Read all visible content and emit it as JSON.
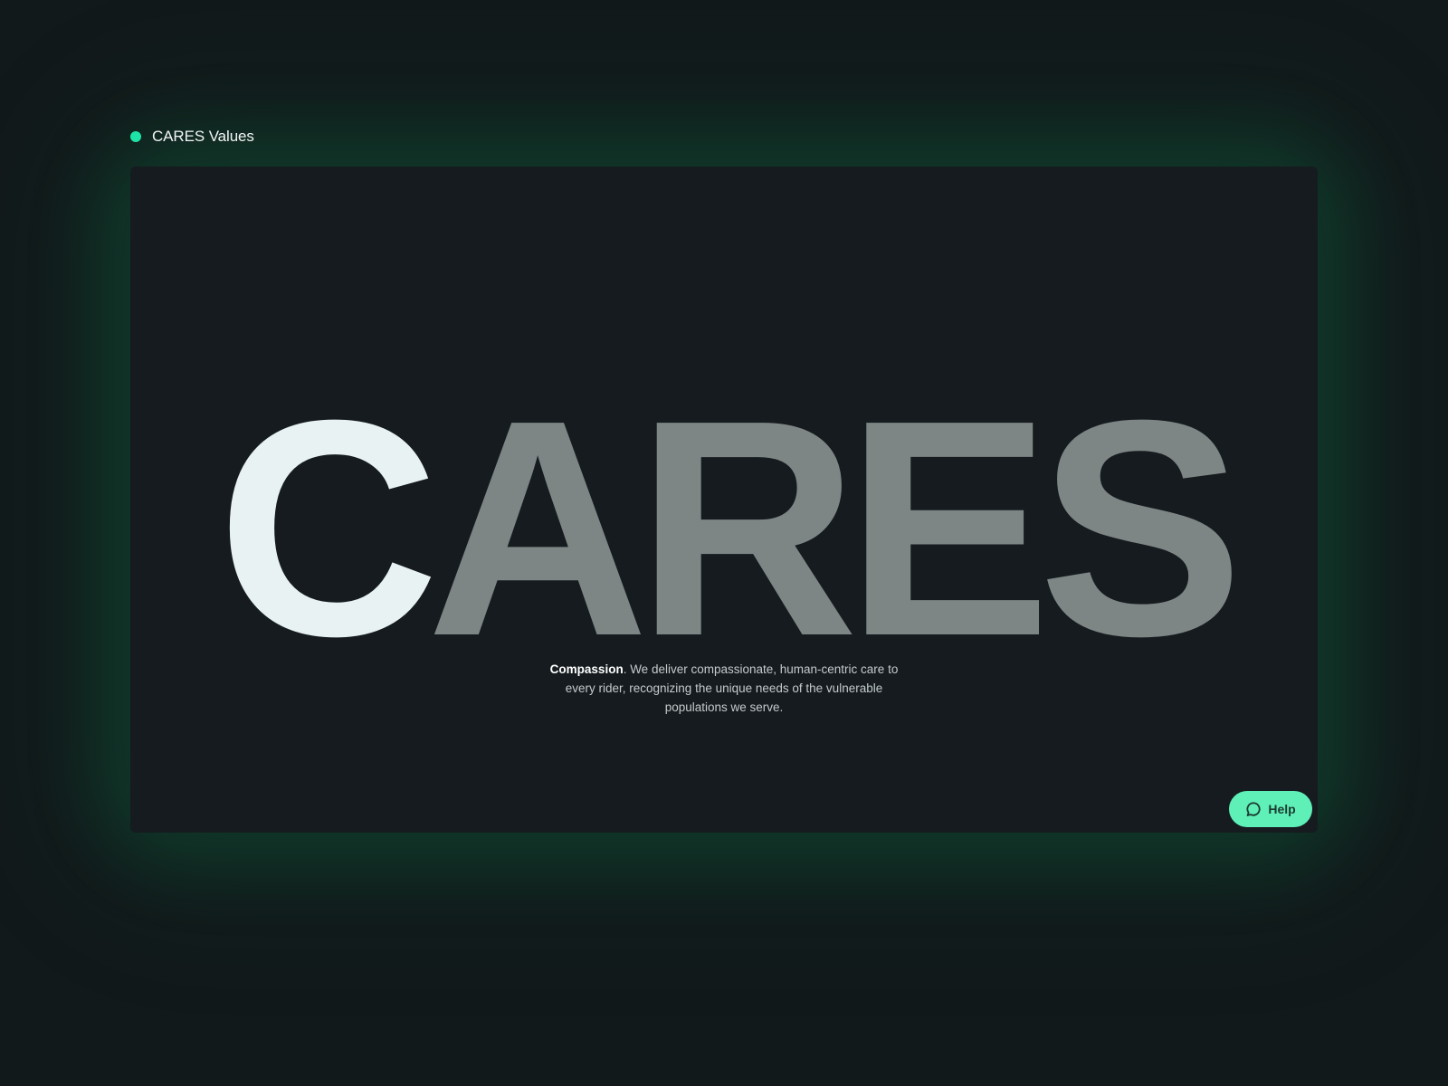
{
  "header": {
    "title": "CARES Values",
    "indicator_color": "#1ee3a6"
  },
  "hero": {
    "letters": [
      "C",
      "A",
      "R",
      "E",
      "S"
    ],
    "active_index": 0,
    "active_color": "#e8f2f3",
    "inactive_color": "#7e8685"
  },
  "value": {
    "name": "Compassion",
    "text": ". We deliver compassionate, human-centric care to every rider, recognizing the unique needs of the vulnerable populations we serve."
  },
  "help_button": {
    "label": "Help",
    "icon": "chat-bubble-icon",
    "color": "#5ff0b8"
  },
  "colors": {
    "page_background": "#12191b",
    "card_background": "#151b1e",
    "glow": "#106e46"
  }
}
